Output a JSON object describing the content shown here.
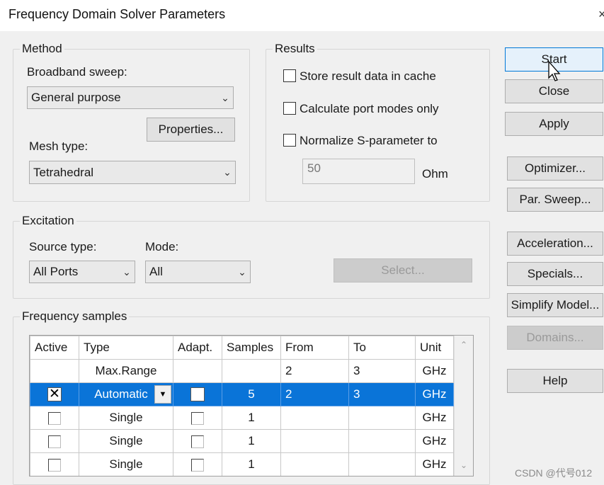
{
  "window": {
    "title": "Frequency Domain Solver Parameters",
    "close_glyph": "×"
  },
  "method": {
    "legend": "Method",
    "broadband_label": "Broadband sweep:",
    "broadband_value": "General purpose",
    "properties_button": "Properties...",
    "mesh_label": "Mesh type:",
    "mesh_value": "Tetrahedral"
  },
  "results": {
    "legend": "Results",
    "store_cache_label": "Store result data in cache",
    "port_modes_label": "Calculate port modes only",
    "normalize_label": "Normalize S-parameter to",
    "normalize_value": "50",
    "normalize_unit": "Ohm"
  },
  "excitation": {
    "legend": "Excitation",
    "source_label": "Source type:",
    "source_value": "All Ports",
    "mode_label": "Mode:",
    "mode_value": "All",
    "select_button": "Select..."
  },
  "frequency": {
    "legend": "Frequency samples",
    "columns": [
      "Active",
      "Type",
      "Adapt.",
      "Samples",
      "From",
      "To",
      "Unit"
    ],
    "maxrange": {
      "type": "Max.Range",
      "from": "2",
      "to": "3",
      "unit": "GHz"
    },
    "rows": [
      {
        "active": true,
        "type": "Automatic",
        "adapt": false,
        "samples": "5",
        "from": "2",
        "to": "3",
        "unit": "GHz"
      },
      {
        "active": false,
        "type": "Single",
        "adapt": false,
        "samples": "1",
        "from": "",
        "to": "",
        "unit": "GHz"
      },
      {
        "active": false,
        "type": "Single",
        "adapt": false,
        "samples": "1",
        "from": "",
        "to": "",
        "unit": "GHz"
      },
      {
        "active": false,
        "type": "Single",
        "adapt": false,
        "samples": "1",
        "from": "",
        "to": "",
        "unit": "GHz"
      }
    ]
  },
  "buttons": {
    "start": "Start",
    "close": "Close",
    "apply": "Apply",
    "optimizer": "Optimizer...",
    "par_sweep": "Par. Sweep...",
    "acceleration": "Acceleration...",
    "specials": "Specials...",
    "simplify": "Simplify Model...",
    "domains": "Domains...",
    "help": "Help"
  },
  "watermark": "CSDN @代号012",
  "colors": {
    "selection": "#0a74d8",
    "default_button_border": "#0078d7"
  }
}
